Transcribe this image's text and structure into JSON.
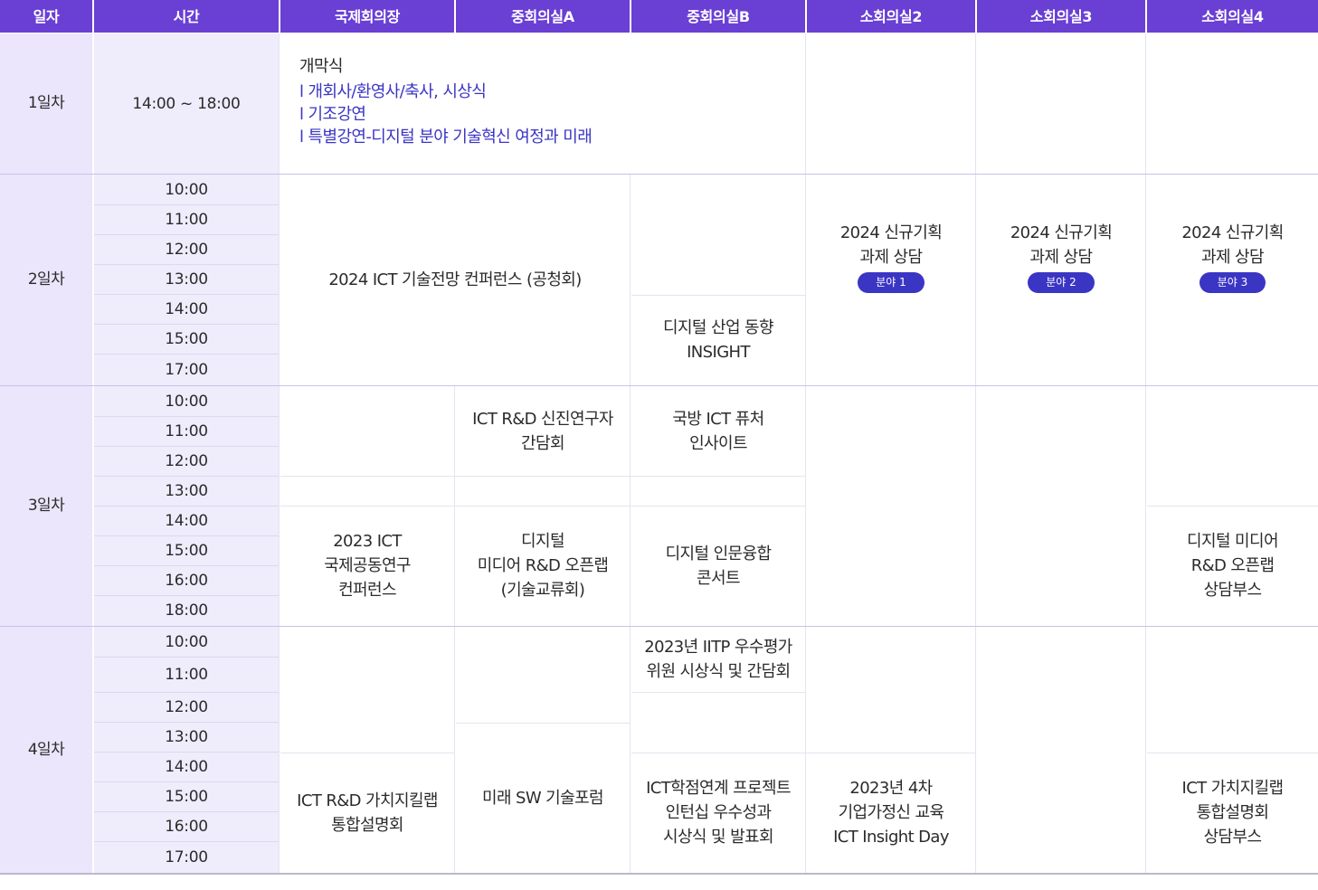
{
  "headers": [
    "일자",
    "시간",
    "국제회의장",
    "중회의실A",
    "중회의실B",
    "소회의실2",
    "소회의실3",
    "소회의실4"
  ],
  "days": {
    "d1": {
      "label": "1일차",
      "time": "14:00 ~ 18:00",
      "opening": {
        "title": "개막식",
        "items": [
          "l 개회사/환영사/축사, 시상식",
          "l 기조강연",
          "l 특별강연-디지털 분야 기술혁신 여정과 미래"
        ]
      }
    },
    "d2": {
      "label": "2일차",
      "times": [
        "10:00",
        "11:00",
        "12:00",
        "13:00",
        "14:00",
        "15:00",
        "17:00"
      ],
      "forecast": "2024 ICT 기술전망 컨퍼런스 (공청회)",
      "insight": [
        "디지털 산업 동향",
        "INSIGHT"
      ],
      "consult": [
        "2024 신규기획",
        "과제 상담"
      ],
      "badges": [
        "분야 1",
        "분야 2",
        "분야 3"
      ]
    },
    "d3": {
      "label": "3일차",
      "times": [
        "10:00",
        "11:00",
        "12:00",
        "13:00",
        "14:00",
        "15:00",
        "16:00",
        "18:00"
      ],
      "joint": [
        "2023 ICT",
        "국제공동연구",
        "컨퍼런스"
      ],
      "newres": [
        "ICT R&D 신진연구자",
        "간담회"
      ],
      "media": [
        "디지털",
        "미디어 R&D 오픈랩",
        "(기술교류회)"
      ],
      "defense": [
        "국방 ICT 퓨처",
        "인사이트"
      ],
      "humanities": [
        "디지털 인문융합",
        "콘서트"
      ],
      "booth": [
        "디지털 미디어",
        "R&D 오픈랩",
        "상담부스"
      ]
    },
    "d4": {
      "label": "4일차",
      "times": [
        "10:00",
        "11:00",
        "12:00",
        "13:00",
        "14:00",
        "15:00",
        "16:00",
        "17:00"
      ],
      "valuechain": [
        "ICT R&D 가치지킬랩",
        "통합설명회"
      ],
      "swforum": "미래 SW 기술포럼",
      "iitp": [
        "2023년 IITP 우수평가",
        "위원 시상식 및 간담회"
      ],
      "intern": [
        "ICT학점연계 프로젝트",
        "인턴십 우수성과",
        "시상식 및 발표회"
      ],
      "family": [
        "2023년 4차",
        "기업가정신 교육",
        "ICT Insight Day"
      ],
      "vcbooth": [
        "ICT 가치지킬랩",
        "통합설명회",
        "상담부스"
      ]
    }
  }
}
